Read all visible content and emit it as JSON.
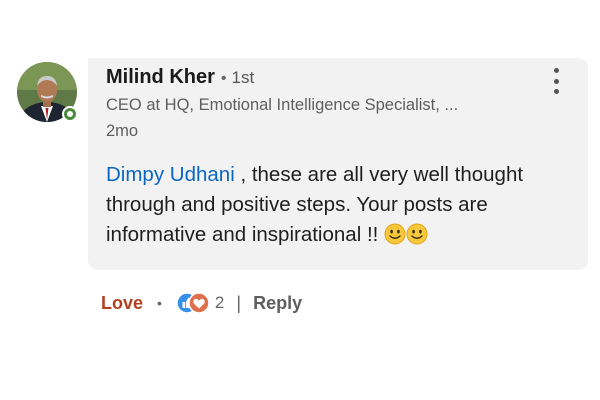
{
  "comment": {
    "author": {
      "name": "Milind Kher",
      "separator": "•",
      "degree": "1st",
      "headline": "CEO at HQ, Emotional Intelligence Specialist, ...",
      "avatar_icon": "profile-photo",
      "status": "online"
    },
    "timestamp": "2mo",
    "more_icon": "vertical-ellipsis-icon",
    "body": {
      "mention": "Dimpy Udhani",
      "text": " , these are all very well thought through and positive steps. Your posts are informative and inspirational !! ",
      "emojis": [
        "slightly-smiling-face",
        "slightly-smiling-face"
      ]
    },
    "actions": {
      "love_label": "Love",
      "dot": "•",
      "reaction_icons": [
        "like-icon",
        "love-icon"
      ],
      "reaction_count": "2",
      "divider": "|",
      "reply_label": "Reply"
    }
  },
  "colors": {
    "mention": "#0a66c2",
    "love": "#b24020",
    "bubble": "#f2f2f2",
    "online": "#4a8a3b",
    "like_blue": "#378fe9",
    "love_red": "#df704d"
  }
}
